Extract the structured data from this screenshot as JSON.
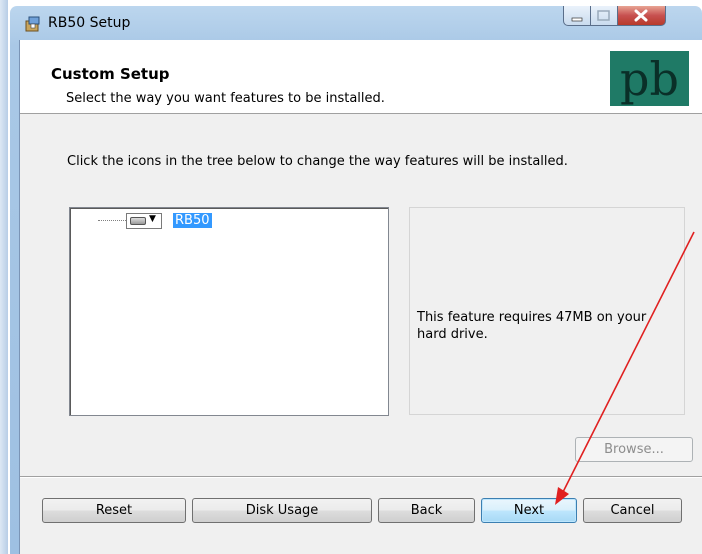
{
  "window": {
    "title": "RB50 Setup",
    "icon": "installer-icon"
  },
  "header": {
    "title": "Custom Setup",
    "subtitle": "Select the way you want features to be installed.",
    "logo_text": "pb",
    "logo_color": "#1f7a66"
  },
  "instructions": "Click the icons in the tree below to change the way features will be installed.",
  "tree": {
    "items": [
      {
        "label": "RB50",
        "icon": "hard-drive-icon",
        "selected": true
      }
    ]
  },
  "info": {
    "text": "This feature requires 47MB on your hard drive."
  },
  "buttons": {
    "browse": "Browse...",
    "reset": "Reset",
    "disk_usage": "Disk Usage",
    "back": "Back",
    "next": "Next",
    "cancel": "Cancel"
  },
  "annotation": {
    "type": "red-arrow",
    "color": "#e02020",
    "points_to": "Next"
  }
}
